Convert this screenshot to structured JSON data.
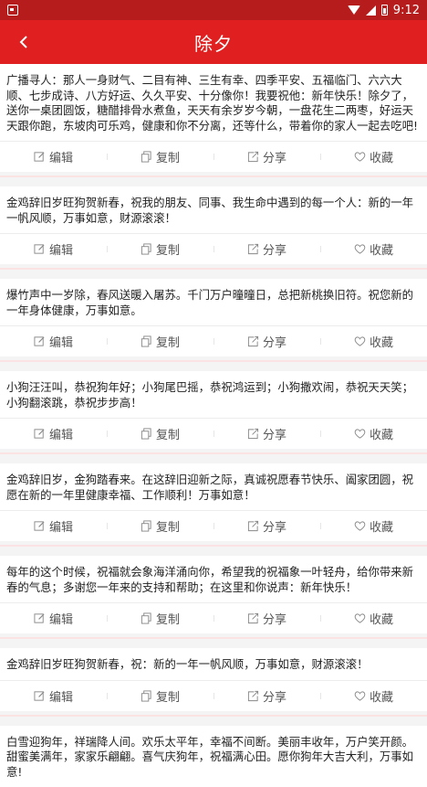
{
  "status_bar": {
    "time": "9:12"
  },
  "app_bar": {
    "title": "除夕"
  },
  "actions": {
    "edit": "编辑",
    "copy": "复制",
    "share": "分享",
    "favorite": "收藏"
  },
  "messages": [
    {
      "text": "广播寻人：那人一身财气、二目有神、三生有幸、四季平安、五福临门、六六大顺、七步成诗、八方好运、久久平安、十分像你！我要祝他：新年快乐！除夕了，送你一桌团圆饭，糖醋排骨水煮鱼，天天有余岁岁今朝，一盘花生二两枣，好运天天跟你跑，东坡肉可乐鸡，健康和你不分离，还等什么，带着你的家人一起去吃吧!"
    },
    {
      "text": "金鸡辞旧岁旺狗贺新春，祝我的朋友、同事、我生命中遇到的每一个人：新的一年一帆风顺，万事如意，财源滚滚！"
    },
    {
      "text": "爆竹声中一岁除，春风送暖入屠苏。千门万户曈曈日，总把新桃换旧符。祝您新的一年身体健康，万事如意。"
    },
    {
      "text": "小狗汪汪叫，恭祝狗年好；小狗尾巴摇，恭祝鸿运到；小狗撒欢闹，恭祝天天笑；小狗翻滚跳，恭祝步步高！"
    },
    {
      "text": "金鸡辞旧岁，金狗踏春来。在这辞旧迎新之际，真诚祝愿春节快乐、阖家团圆，祝愿在新的一年里健康幸福、工作顺利！万事如意！"
    },
    {
      "text": "每年的这个时候，祝福就会象海洋涌向你，希望我的祝福象一叶轻舟，给你带来新春的气息；多谢您一年来的支持和帮助；在这里和你说声：新年快乐！"
    },
    {
      "text": "金鸡辞旧岁旺狗贺新春，祝：新的一年一帆风顺，万事如意，财源滚滚！"
    },
    {
      "text": "白雪迎狗年，祥瑞降人间。欢乐太平年，幸福不间断。美丽丰收年，万户笑开颜。甜蜜美满年，家家乐翩翩。喜气庆狗年，祝福满心田。愿你狗年大吉大利，万事如意!"
    }
  ]
}
